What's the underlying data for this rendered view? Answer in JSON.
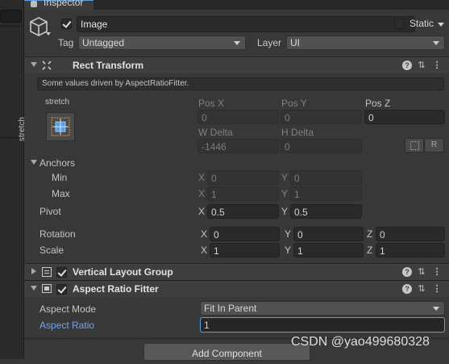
{
  "tab": {
    "title": "Inspector"
  },
  "object": {
    "name": "Image",
    "static_label": "Static",
    "tag_label": "Tag",
    "tag_value": "Untagged",
    "layer_label": "Layer",
    "layer_value": "UI"
  },
  "rect_transform": {
    "title": "Rect Transform",
    "driven_message": "Some values driven by AspectRatioFitter.",
    "anchor_preset_top": "stretch",
    "anchor_preset_side": "stretch",
    "pos_x_label": "Pos X",
    "pos_x": "0",
    "pos_y_label": "Pos Y",
    "pos_y": "0",
    "pos_z_label": "Pos Z",
    "pos_z": "0",
    "w_delta_label": "W Delta",
    "w_delta": "-1446",
    "h_delta_label": "H Delta",
    "h_delta": "0",
    "raw_edit_label": "R",
    "anchors_label": "Anchors",
    "min_label": "Min",
    "min_x": "0",
    "min_y": "0",
    "max_label": "Max",
    "max_x": "1",
    "max_y": "1",
    "pivot_label": "Pivot",
    "pivot_x": "0.5",
    "pivot_y": "0.5",
    "rotation_label": "Rotation",
    "rot_x": "0",
    "rot_y": "0",
    "rot_z": "0",
    "scale_label": "Scale",
    "scale_x": "1",
    "scale_y": "1",
    "scale_z": "1",
    "axis_x": "X",
    "axis_y": "Y",
    "axis_z": "Z"
  },
  "vertical_layout_group": {
    "title": "Vertical Layout Group"
  },
  "aspect_ratio_fitter": {
    "title": "Aspect Ratio Fitter",
    "aspect_mode_label": "Aspect Mode",
    "aspect_mode_value": "Fit In Parent",
    "aspect_ratio_label": "Aspect Ratio",
    "aspect_ratio_value": "1"
  },
  "add_component_label": "Add Component",
  "watermark": "CSDN @yao499680328",
  "icons": {
    "help": "?",
    "settings": "⇅",
    "more": "⋮"
  },
  "colors": {
    "accent": "#5a9ee6",
    "background": "#383838",
    "label_blue": "#78a5e8"
  }
}
